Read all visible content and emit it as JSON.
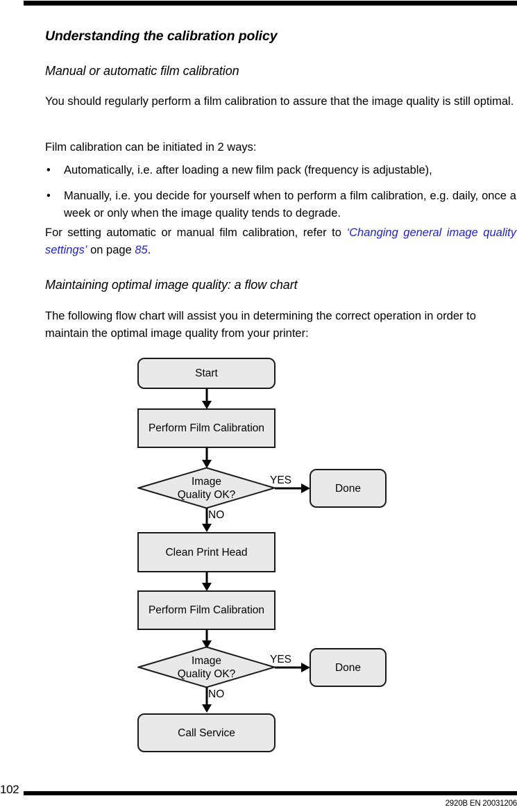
{
  "page": {
    "number": "102",
    "doc_code": "2920B EN 20031206",
    "link_color": "#2222cc",
    "node_fill": "#e9e9e9"
  },
  "headings": {
    "title": "Understanding the calibration policy",
    "section_1": "Manual or automatic film calibration",
    "section_2": "Maintaining optimal image quality: a flow chart"
  },
  "paragraphs": {
    "intro": "You should regularly perform a film calibration to assure that the image quality is still optimal.",
    "two_ways": "Film calibration can be initiated in 2 ways:",
    "refer_prefix": "For setting automatic or manual film calibration, refer to ",
    "refer_link": "‘Changing general image quality settings’",
    "refer_mid": " on page ",
    "refer_page": "85",
    "refer_suffix": ".",
    "flowchart_intro": "The following flow chart will assist you in determining the correct operation in order to maintain the optimal image quality from your printer:"
  },
  "bullets": [
    {
      "marker": "•",
      "text": "Automatically, i.e. after loading a new film pack (frequency is adjustable),"
    },
    {
      "marker": "•",
      "text": "Manually, i.e. you decide for yourself when to perform a film calibration, e.g. daily, once a week or only when the image quality tends to degrade."
    }
  ],
  "chart_data": {
    "type": "diagram",
    "title": "Maintaining optimal image quality: a flow chart",
    "nodes": [
      {
        "id": "start",
        "label": "Start",
        "shape": "rounded-rect"
      },
      {
        "id": "calib1",
        "label": "Perform Film Calibration",
        "shape": "rect"
      },
      {
        "id": "quality1",
        "label_line1": "Image",
        "label_line2": "Quality OK?",
        "shape": "diamond"
      },
      {
        "id": "done1",
        "label": "Done",
        "shape": "rounded-rect"
      },
      {
        "id": "clean",
        "label": "Clean Print Head",
        "shape": "rect"
      },
      {
        "id": "calib2",
        "label": "Perform Film Calibration",
        "shape": "rect"
      },
      {
        "id": "quality2",
        "label_line1": "Image",
        "label_line2": "Quality OK?",
        "shape": "diamond"
      },
      {
        "id": "done2",
        "label": "Done",
        "shape": "rounded-rect"
      },
      {
        "id": "service",
        "label": "Call Service",
        "shape": "rounded-rect"
      }
    ],
    "edges": [
      {
        "from": "start",
        "to": "calib1",
        "label": ""
      },
      {
        "from": "calib1",
        "to": "quality1",
        "label": ""
      },
      {
        "from": "quality1",
        "to": "done1",
        "label": "YES"
      },
      {
        "from": "quality1",
        "to": "clean",
        "label": "NO"
      },
      {
        "from": "clean",
        "to": "calib2",
        "label": ""
      },
      {
        "from": "calib2",
        "to": "quality2",
        "label": ""
      },
      {
        "from": "quality2",
        "to": "done2",
        "label": "YES"
      },
      {
        "from": "quality2",
        "to": "service",
        "label": "NO"
      }
    ],
    "edge_labels": {
      "yes_1": "YES",
      "no_1": "NO",
      "yes_2": "YES",
      "no_2": "NO"
    }
  }
}
